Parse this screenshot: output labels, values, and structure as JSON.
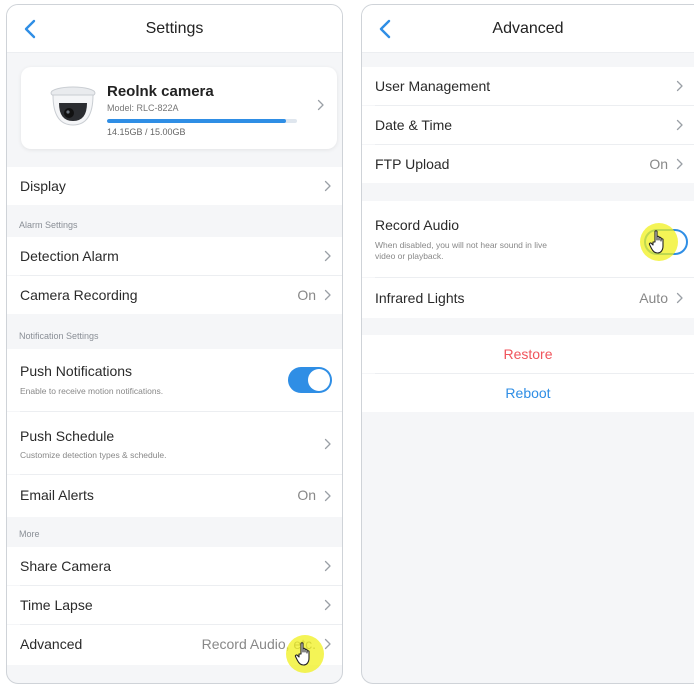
{
  "colors": {
    "accent": "#2f8ee5",
    "danger": "#f0545c",
    "highlight": "#f0f01e"
  },
  "left": {
    "title": "Settings",
    "camera": {
      "name": "Reolnk camera",
      "model": "Model: RLC-822A",
      "storage": "14.15GB / 15.00GB",
      "storage_used_fraction": 0.943
    },
    "display": "Display",
    "alarm_section": "Alarm Settings",
    "detection_alarm": "Detection Alarm",
    "camera_recording": {
      "label": "Camera Recording",
      "value": "On"
    },
    "notification_section": "Notification Settings",
    "push_notifications": {
      "label": "Push Notifications",
      "sub": "Enable to receive motion notifications.",
      "enabled": true
    },
    "push_schedule": {
      "label": "Push Schedule",
      "sub": "Customize detection types & schedule."
    },
    "email_alerts": {
      "label": "Email Alerts",
      "value": "On"
    },
    "more_section": "More",
    "share_camera": "Share Camera",
    "time_lapse": "Time Lapse",
    "advanced": {
      "label": "Advanced",
      "value": "Record Audio, etc."
    }
  },
  "right": {
    "title": "Advanced",
    "user_management": "User Management",
    "date_time": "Date & Time",
    "ftp_upload": {
      "label": "FTP Upload",
      "value": "On"
    },
    "record_audio": {
      "label": "Record Audio",
      "sub_line1": "When disabled, you will not hear sound in live",
      "sub_line2": "video or playback."
    },
    "infrared_lights": {
      "label": "Infrared Lights",
      "value": "Auto"
    },
    "restore": "Restore",
    "reboot": "Reboot"
  }
}
